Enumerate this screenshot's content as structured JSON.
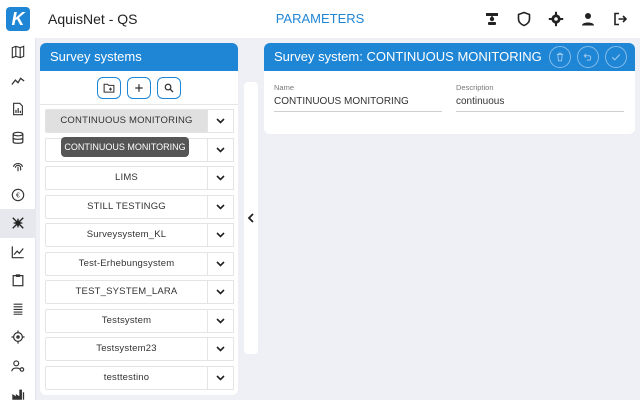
{
  "app": {
    "title": "AquisNet - QS",
    "logo_letter": "K",
    "section_title": "PARAMETERS"
  },
  "top_icons": [
    "user-group-icon",
    "shield-icon",
    "gear-icon",
    "user-icon",
    "logout-icon"
  ],
  "nav_icons": [
    "map-icon",
    "trend-icon",
    "report-icon",
    "database-icon",
    "fingerprint-icon",
    "euro-icon",
    "bug-icon",
    "chart-icon",
    "clipboard-icon",
    "layers-icon",
    "target-icon",
    "user-settings-icon",
    "factory-icon"
  ],
  "left_panel": {
    "title": "Survey systems",
    "toolbar": {
      "folder_icon": "add-folder-icon",
      "add_icon": "plus-icon",
      "search_icon": "search-icon"
    },
    "items": [
      {
        "label": "CONTINUOUS MONITORING",
        "selected": true
      },
      {
        "label": "",
        "selected": false
      },
      {
        "label": "LIMS",
        "selected": false
      },
      {
        "label": "STILL TESTINGG",
        "selected": false
      },
      {
        "label": "Surveysystem_KL",
        "selected": false
      },
      {
        "label": "Test-Erhebungsystem",
        "selected": false
      },
      {
        "label": "TEST_SYSTEM_LARA",
        "selected": false
      },
      {
        "label": "Testsystem",
        "selected": false
      },
      {
        "label": "Testsystem23",
        "selected": false
      },
      {
        "label": "testtestino",
        "selected": false
      }
    ],
    "tooltip": "CONTINUOUS MONITORING"
  },
  "right_panel": {
    "title": "Survey system: CONTINUOUS MONITORING",
    "name_label": "Name",
    "name_value": "CONTINUOUS MONITORING",
    "description_label": "Description",
    "description_value": "continuous",
    "header_buttons": [
      "delete-icon",
      "undo-icon",
      "check-icon"
    ]
  }
}
